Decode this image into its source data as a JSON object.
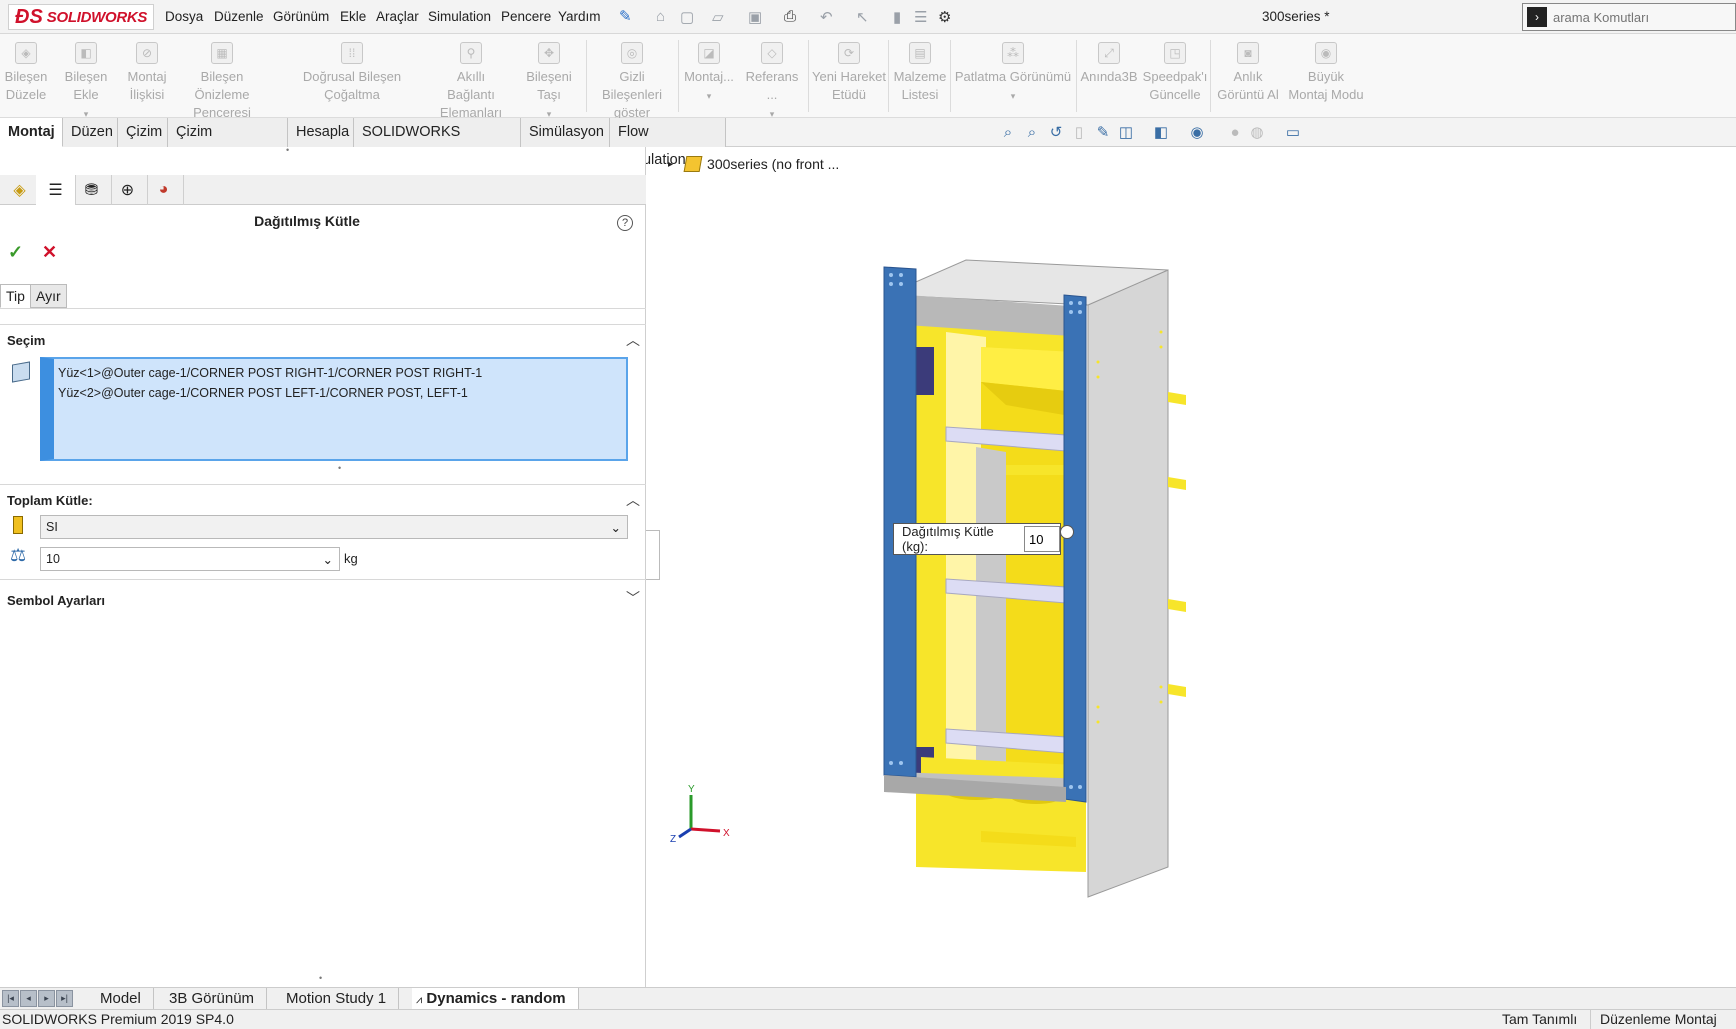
{
  "app": {
    "brand": "SOLIDWORKS",
    "document_title": "300series *",
    "search_placeholder": "arama Komutları"
  },
  "menu": [
    "Dosya",
    "Düzenle",
    "Görünüm",
    "Ekle",
    "Araçlar",
    "Simulation",
    "Pencere",
    "Yardım"
  ],
  "ribbon": [
    {
      "line1": "Bileşen",
      "line2": "Düzele"
    },
    {
      "line1": "Bileşen Ekle",
      "line2": ""
    },
    {
      "line1": "Montaj",
      "line2": "İlişkisi"
    },
    {
      "line1": "Bileşen Önizleme",
      "line2": "Penceresi"
    },
    {
      "line1": "Doğrusal Bileşen Çoğaltma",
      "line2": ""
    },
    {
      "line1": "Akıllı Bağlantı",
      "line2": "Elemanları"
    },
    {
      "line1": "Bileşeni Taşı",
      "line2": ""
    },
    {
      "line1": "Gizli Bileşenleri",
      "line2": "göster"
    },
    {
      "line1": "Montaj...",
      "line2": ""
    },
    {
      "line1": "Referans ...",
      "line2": ""
    },
    {
      "line1": "Yeni Hareket",
      "line2": "Etüdü"
    },
    {
      "line1": "Malzeme",
      "line2": "Listesi"
    },
    {
      "line1": "Patlatma Görünümü",
      "line2": ""
    },
    {
      "line1": "Anında3B",
      "line2": ""
    },
    {
      "line1": "Speedpak'ı",
      "line2": "Güncelle"
    },
    {
      "line1": "Anlık",
      "line2": "Görüntü Al"
    },
    {
      "line1": "Büyük",
      "line2": "Montaj Modu"
    }
  ],
  "command_tabs": [
    "Montaj",
    "Düzen",
    "Çizim",
    "Çizim Mürekkebi",
    "Hesapla",
    "SOLIDWORKS Eklentileri",
    "Simülasyon",
    "Flow Simulation"
  ],
  "property_manager": {
    "title": "Dağıtılmış Kütle",
    "subtabs": [
      "Tip",
      "Ayır"
    ],
    "selection_title": "Seçim",
    "selection_items": [
      "Yüz<1>@Outer cage-1/CORNER POST RIGHT-1/CORNER POST RIGHT-1",
      "Yüz<2>@Outer cage-1/CORNER POST LEFT-1/CORNER POST, LEFT-1"
    ],
    "total_mass_title": "Toplam Kütle:",
    "unit_system": "SI",
    "mass_value": "10",
    "mass_unit": "kg",
    "symbol_settings_title": "Sembol Ayarları"
  },
  "tree": {
    "root_label": "300series  (no front ..."
  },
  "tooltip": {
    "label": "Dağıtılmış Kütle (kg):",
    "value": "10"
  },
  "triad": {
    "x": "X",
    "y": "Y",
    "z": "Z"
  },
  "bottom_tabs": [
    "Model",
    "3B Görünüm",
    "Motion Study 1",
    "Dynamics - random"
  ],
  "status": {
    "product": "SOLIDWORKS Premium 2019 SP4.0",
    "definition": "Tam Tanımlı",
    "mode": "Düzenleme Montaj"
  },
  "colors": {
    "brand_red": "#d0112b",
    "selection_blue": "#3d8fe0",
    "model_yellow": "#f7e52a",
    "model_gray": "#c8c8c8"
  }
}
